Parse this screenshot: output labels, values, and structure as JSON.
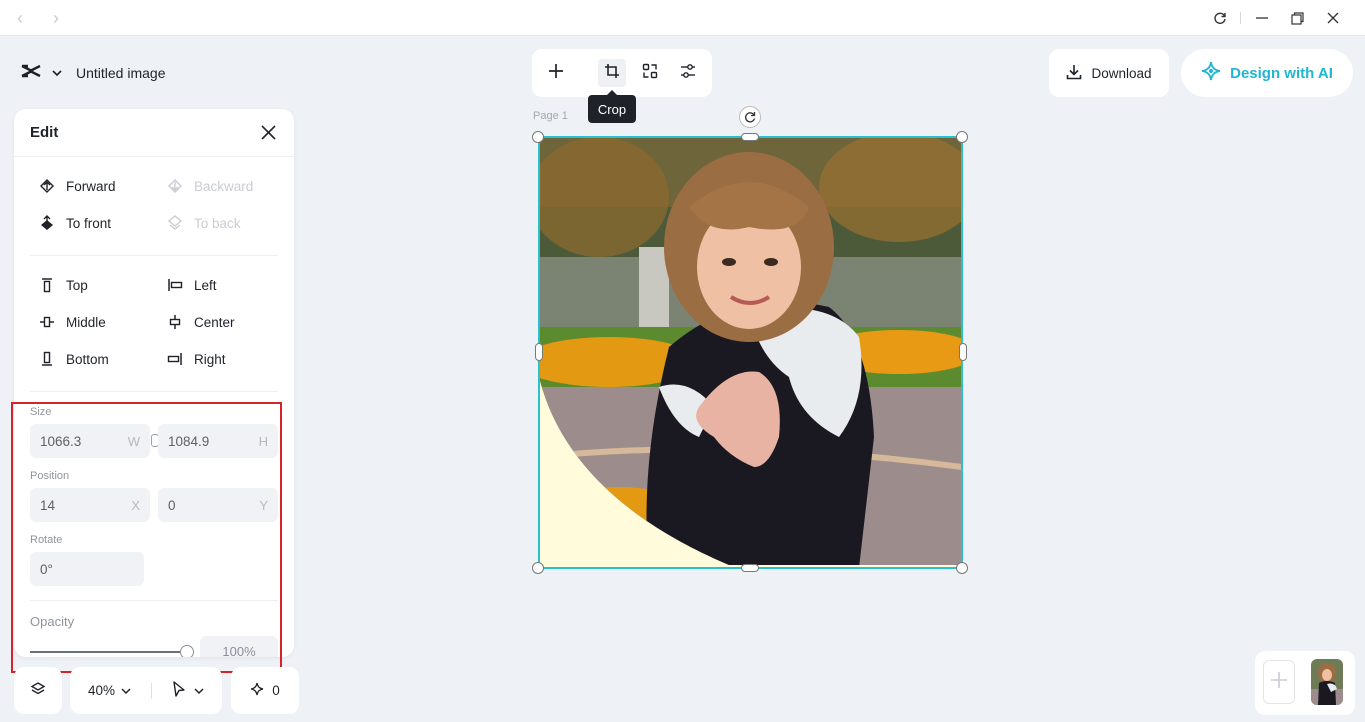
{
  "app": {
    "doc_title": "Untitled image"
  },
  "edit_panel": {
    "title": "Edit",
    "arrange": {
      "forward": "Forward",
      "backward": "Backward",
      "to_front": "To front",
      "to_back": "To back"
    },
    "align": {
      "top": "Top",
      "left": "Left",
      "middle": "Middle",
      "center": "Center",
      "bottom": "Bottom",
      "right": "Right"
    },
    "size": {
      "label": "Size",
      "width": "1066.3",
      "width_unit": "W",
      "height": "1084.9",
      "height_unit": "H"
    },
    "position": {
      "label": "Position",
      "x": "14",
      "x_unit": "X",
      "y": "0",
      "y_unit": "Y"
    },
    "rotate": {
      "label": "Rotate",
      "value": "0°"
    },
    "opacity": {
      "label": "Opacity",
      "value": "100%",
      "level": 1.0
    }
  },
  "toolbar": {
    "tooltip": "Crop"
  },
  "actions": {
    "download": "Download",
    "design_ai": "Design with AI"
  },
  "canvas": {
    "page_label": "Page 1"
  },
  "bottom_bar": {
    "zoom": "40%",
    "count": "0"
  },
  "colors": {
    "accent": "#1fb6d1",
    "selection": "#2ac0cf",
    "highlight": "#d6232a"
  }
}
